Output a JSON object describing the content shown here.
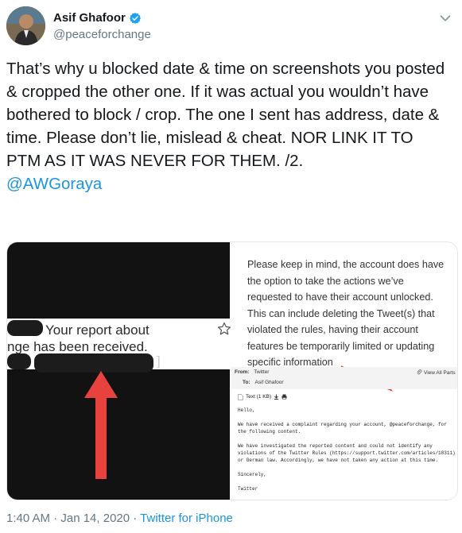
{
  "author": {
    "name": "Asif Ghafoor",
    "handle": "@peaceforchange",
    "verified_icon": "verified-badge-icon",
    "verified_color": "#1da1f2"
  },
  "tweet": {
    "text": "That’s why u blocked date & time on screenshots you posted & cropped the other one. If it was actual you wouldn’t have bothered to block / crop. The one I sent has address, date & time. Please don’t lie, mislead & cheat. NOR LINK IT TO PTM AS IT WAS NEVER FOR THEM. /2.",
    "mention": "@AWGoraya"
  },
  "media": {
    "left": {
      "line1": "Your report about",
      "line2": "nge has been received.",
      "bracket": "]",
      "arrow_color": "#e8423f"
    },
    "right": {
      "notice": "Please keep in mind, the account does have the option to take the actions we’ve requested to have their account unlocked. This can include deleting the Tweet(s) that violated the rules, having their account features be temporarily limited or updating specific information",
      "from_label": "From:",
      "from_value": "Twitter",
      "to_label": "To:",
      "to_value": "Asif Ghafoor",
      "view_all": "View All Parts",
      "attachment": "Text (1 KB)",
      "greeting": "Hello,",
      "para1": "We have received a complaint regarding your account, @peaceforchange, for the following content.",
      "para2": "We have investigated the reported content and could not identify any violations of the Twitter Rules (https://support.twitter.com/articles/18311) or German law.  Accordingly, we have not taken any action at this time.",
      "closing": "Sincerely,",
      "signature": "Twitter"
    }
  },
  "footer": {
    "time": "1:40 AM · Jan 14, 2020 · ",
    "source": "Twitter for iPhone"
  }
}
